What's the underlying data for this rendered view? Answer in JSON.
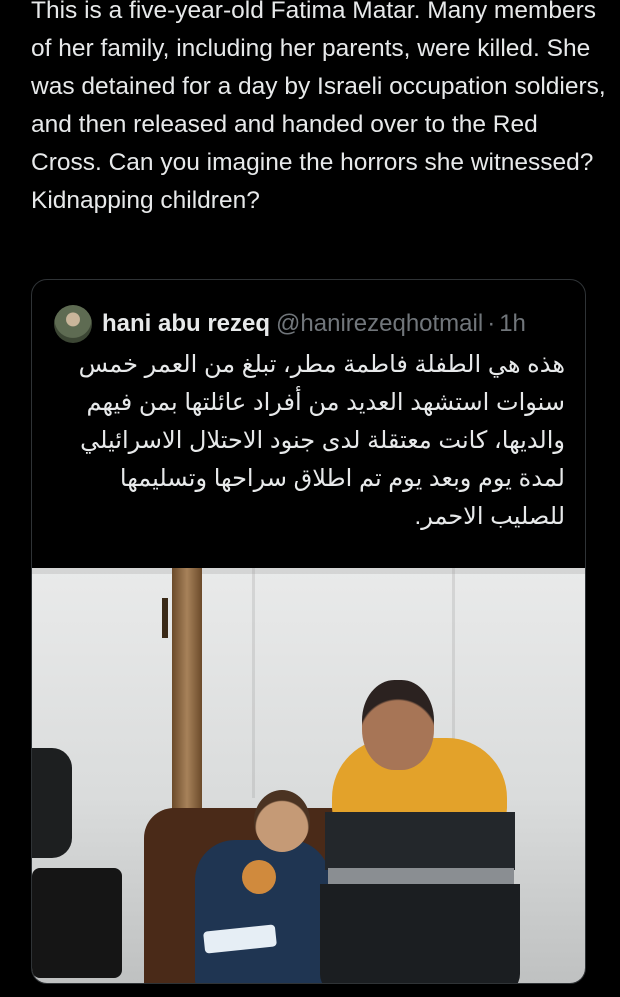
{
  "tweet": {
    "text": "This is a five-year-old Fatima Matar. Many members of her family, including her parents, were killed. She was detained for a day by Israeli occupation soldiers, and then released and handed over to the Red Cross. Can you imagine the horrors she witnessed? Kidnapping children?"
  },
  "quote": {
    "author_name": "hani abu rezeq",
    "handle": "@hanirezeqhotmail",
    "separator": "·",
    "time": "1h",
    "text": "هذه هي الطفلة فاطمة مطر، تبلغ من العمر خمس سنوات استشهد العديد من أفراد عائلتها بمن فيهم والديها، كانت معتقلة لدى جنود الاحتلال الاسرائيلي لمدة يوم وبعد يوم تم اطلاق سراحها وتسليمها للصليب الاحمر."
  }
}
